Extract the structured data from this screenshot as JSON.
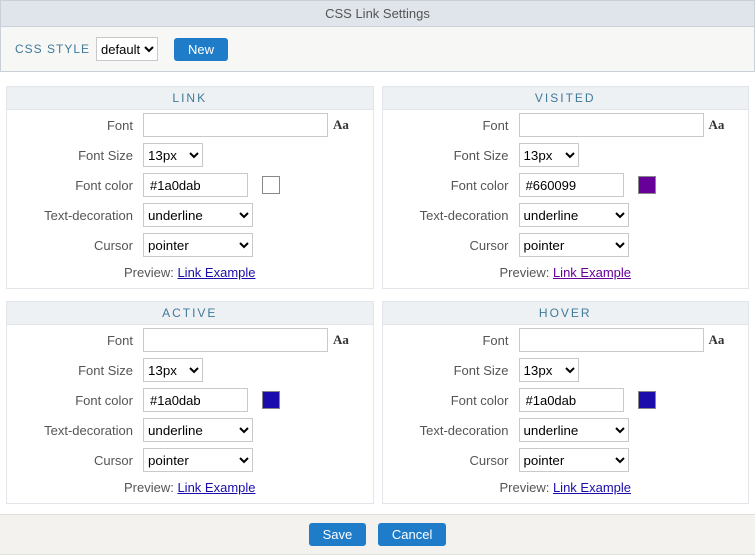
{
  "title": "CSS Link Settings",
  "toolbar": {
    "style_label": "CSS STYLE",
    "style_value": "default",
    "new_btn": "New"
  },
  "labels": {
    "font": "Font",
    "font_size": "Font Size",
    "font_color": "Font color",
    "text_decoration": "Text-decoration",
    "cursor": "Cursor",
    "preview_prefix": "Preview: ",
    "preview_link": "Link Example",
    "aa": "Aa"
  },
  "panels": {
    "link": {
      "heading": "LINK",
      "font": "",
      "size": "13px",
      "color": "#1a0dab",
      "decoration": "underline",
      "cursor": "pointer"
    },
    "visited": {
      "heading": "VISITED",
      "font": "",
      "size": "13px",
      "color": "#660099",
      "decoration": "underline",
      "cursor": "pointer"
    },
    "active": {
      "heading": "ACTIVE",
      "font": "",
      "size": "13px",
      "color": "#1a0dab",
      "decoration": "underline",
      "cursor": "pointer"
    },
    "hover": {
      "heading": "HOVER",
      "font": "",
      "size": "13px",
      "color": "#1a0dab",
      "decoration": "underline",
      "cursor": "pointer"
    }
  },
  "footer": {
    "save": "Save",
    "cancel": "Cancel"
  }
}
